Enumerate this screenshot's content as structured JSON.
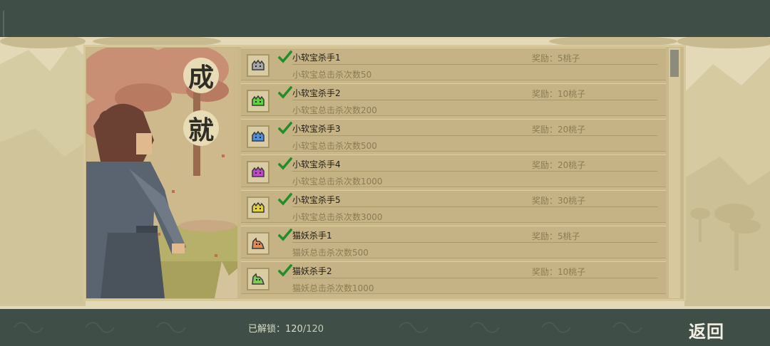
{
  "title_chars": [
    "成",
    "就"
  ],
  "achievements": [
    {
      "name": "小软宝杀手1",
      "desc": "小软宝总击杀次数50",
      "reward": "奖励：5桃子",
      "icon": "slime-gray-icon",
      "color": "#a7a7a7"
    },
    {
      "name": "小软宝杀手2",
      "desc": "小软宝总击杀次数200",
      "reward": "奖励：10桃子",
      "icon": "slime-green-icon",
      "color": "#5dd43c"
    },
    {
      "name": "小软宝杀手3",
      "desc": "小软宝总击杀次数500",
      "reward": "奖励：20桃子",
      "icon": "slime-blue-icon",
      "color": "#4c8fdc"
    },
    {
      "name": "小软宝杀手4",
      "desc": "小软宝总击杀次数1000",
      "reward": "奖励：20桃子",
      "icon": "slime-purple-icon",
      "color": "#c347c9"
    },
    {
      "name": "小软宝杀手5",
      "desc": "小软宝总击杀次数3000",
      "reward": "奖励：30桃子",
      "icon": "slime-yellow-icon",
      "color": "#e3d23c"
    },
    {
      "name": "猫妖杀手1",
      "desc": "猫妖总击杀次数500",
      "reward": "奖励：5桃子",
      "icon": "cat-demon-orange-icon",
      "color": "#e48a52"
    },
    {
      "name": "猫妖杀手2",
      "desc": "猫妖总击杀次数1000",
      "reward": "奖励：10桃子",
      "icon": "cat-demon-green-icon",
      "color": "#7fca55"
    }
  ],
  "footer": {
    "unlock_label": "已解锁：",
    "unlock_done": "120",
    "unlock_sep": "/",
    "unlock_total": "120",
    "back_label": "返回"
  }
}
